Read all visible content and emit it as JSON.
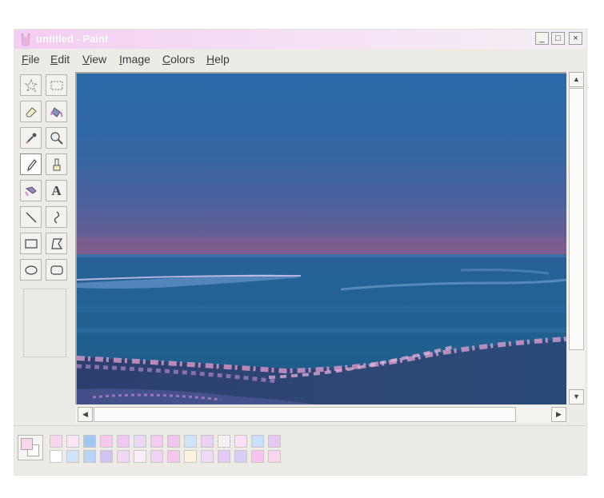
{
  "window": {
    "title": "untitled - Paint",
    "controls": {
      "minimize": "_",
      "maximize": "□",
      "close": "×"
    }
  },
  "menu": [
    "File",
    "Edit",
    "View",
    "Image",
    "Colors",
    "Help"
  ],
  "tools": [
    {
      "name": "free-form-select-tool",
      "icon": "star-select-icon"
    },
    {
      "name": "select-tool",
      "icon": "rect-select-icon"
    },
    {
      "name": "eraser-tool",
      "icon": "eraser-icon"
    },
    {
      "name": "fill-with-color-tool",
      "icon": "paint-bucket-icon"
    },
    {
      "name": "pick-color-tool",
      "icon": "eyedropper-icon"
    },
    {
      "name": "magnifier-tool",
      "icon": "magnifier-icon"
    },
    {
      "name": "pencil-tool",
      "icon": "pencil-icon",
      "active": true
    },
    {
      "name": "brush-tool",
      "icon": "brush-icon"
    },
    {
      "name": "airbrush-tool",
      "icon": "airbrush-icon"
    },
    {
      "name": "text-tool",
      "icon": "text-icon",
      "glyph": "A"
    },
    {
      "name": "line-tool",
      "icon": "line-icon"
    },
    {
      "name": "curve-tool",
      "icon": "curve-icon"
    },
    {
      "name": "rectangle-tool",
      "icon": "rectangle-icon"
    },
    {
      "name": "polygon-tool",
      "icon": "polygon-icon"
    },
    {
      "name": "ellipse-tool",
      "icon": "ellipse-icon"
    },
    {
      "name": "rounded-rectangle-tool",
      "icon": "rounded-rectangle-icon"
    }
  ],
  "colors": {
    "foreground": "#f9d6ef",
    "background": "#ffffff",
    "palette_top": [
      "#f9d6ef",
      "#fbe4f5",
      "#9fc8f3",
      "#f6c9ec",
      "#f2c7ef",
      "#e8d7f5",
      "#f0cdef",
      "#f2c5f0",
      "#cfe5fa",
      "#ecd1f5",
      "#f8f1f6",
      "#fadff3",
      "#c6e0f8",
      "#e6c8f4"
    ],
    "palette_bottom": [
      "#ffffff",
      "#cfe3fb",
      "#b7d6f6",
      "#d2c2f0",
      "#f2d7f4",
      "#fbeef8",
      "#f0d3f2",
      "#f5c7ee",
      "#fbf3dc",
      "#f0d9f5",
      "#e3c9f5",
      "#d8cff7",
      "#f6c4ec",
      "#fbd4f0"
    ]
  },
  "canvas": {
    "scene": "ocean-beach-photo"
  }
}
